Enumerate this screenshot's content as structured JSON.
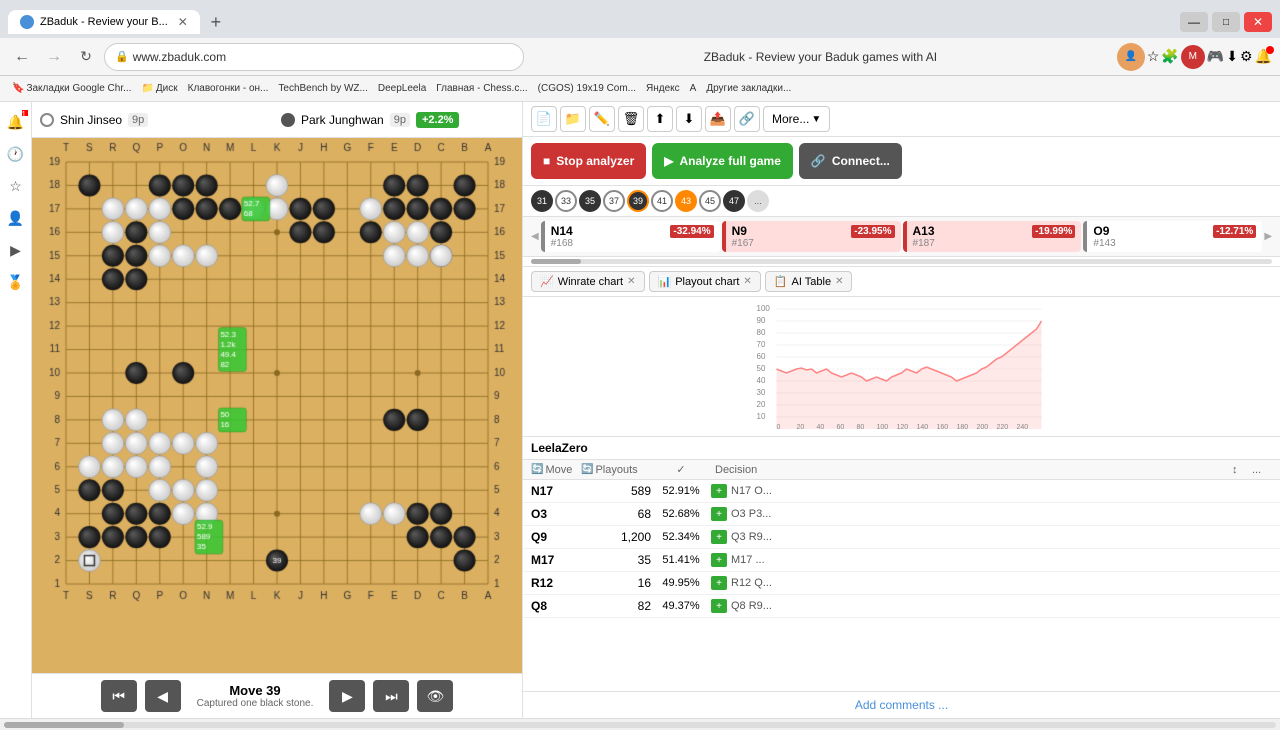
{
  "browser": {
    "tab_title": "ZBaduk - Review your B...",
    "url": "www.zbaduk.com",
    "page_title": "ZBaduk - Review your Baduk games with AI",
    "bookmarks": [
      {
        "label": "Закладки Google Chr...",
        "favicon": true
      },
      {
        "label": "Диск",
        "favicon": true
      },
      {
        "label": "Клавогонки - он...",
        "favicon": true
      },
      {
        "label": "TechBench by WZ...",
        "favicon": true
      },
      {
        "label": "DeepLeela",
        "favicon": true
      },
      {
        "label": "Главная - Chess.c...",
        "favicon": true
      },
      {
        "label": "(CGOS) 19x19 Com...",
        "favicon": true
      },
      {
        "label": "Яндекс",
        "favicon": true
      },
      {
        "label": "А",
        "favicon": true
      },
      {
        "label": "Другие закладки...",
        "favicon": false
      }
    ]
  },
  "players": {
    "white": {
      "name": "Shin Jinseo",
      "rank": "9p",
      "stone": "white"
    },
    "black": {
      "name": "Park Junghwan",
      "rank": "9p",
      "stone": "black"
    },
    "score_diff": "+2.2%"
  },
  "game": {
    "move_number": "Move 39",
    "move_sub": "Captured one black stone."
  },
  "toolbar": {
    "more_label": "More...",
    "stop_label": "Stop analyzer",
    "analyze_label": "Analyze full game",
    "connect_label": "Connect..."
  },
  "move_sequence": [
    {
      "num": "31",
      "color": "black"
    },
    {
      "num": "33",
      "color": "white"
    },
    {
      "num": "35",
      "color": "black"
    },
    {
      "num": "37",
      "color": "white"
    },
    {
      "num": "39",
      "color": "black",
      "current": true
    },
    {
      "num": "41",
      "color": "white"
    },
    {
      "num": "43",
      "color": "black",
      "highlight": true
    },
    {
      "num": "45",
      "color": "white"
    },
    {
      "num": "47",
      "color": "black"
    },
    {
      "num": "...",
      "color": "white"
    }
  ],
  "analysis_cards": [
    {
      "move": "N14",
      "num": "#168",
      "loss": "-32.94%"
    },
    {
      "move": "N9",
      "num": "#167",
      "loss": "-23.95%"
    },
    {
      "move": "A13",
      "num": "#187",
      "loss": "-19.99%"
    },
    {
      "move": "O9",
      "num": "#143",
      "loss": "-12.71%"
    }
  ],
  "chart": {
    "winrate_tab": "Winrate chart",
    "playout_tab": "Playout chart",
    "ai_table_tab": "AI Table",
    "y_labels": [
      "100",
      "90",
      "80",
      "70",
      "60",
      "50",
      "40",
      "30",
      "20",
      "10"
    ],
    "x_labels": [
      "0",
      "20",
      "40",
      "60",
      "80",
      "100",
      "120",
      "140",
      "160",
      "180",
      "200",
      "220",
      "240"
    ]
  },
  "ai_table": {
    "engine": "LeelaZero",
    "headers": {
      "move": "Move",
      "playouts": "Playouts",
      "winrate_check": "✓",
      "decision": "Decision",
      "sort": "↕",
      "extra": "..."
    },
    "rows": [
      {
        "move": "N17",
        "playouts": "589",
        "winrate": "52.91%",
        "decision": "N17 O...",
        "has_plus": true
      },
      {
        "move": "O3",
        "playouts": "68",
        "winrate": "52.68%",
        "decision": "O3 P3...",
        "has_plus": true
      },
      {
        "move": "Q9",
        "playouts": "1,200",
        "winrate": "52.34%",
        "decision": "Q3 R9...",
        "has_plus": true
      },
      {
        "move": "M17",
        "playouts": "35",
        "winrate": "51.41%",
        "decision": "M17 ...",
        "has_plus": true
      },
      {
        "move": "R12",
        "playouts": "16",
        "winrate": "49.95%",
        "decision": "R12 Q...",
        "has_plus": true
      },
      {
        "move": "Q8",
        "playouts": "82",
        "winrate": "49.37%",
        "decision": "Q8 R9...",
        "has_plus": true
      }
    ],
    "add_comments": "Add comments ..."
  },
  "board": {
    "size": 19,
    "column_labels": [
      "T",
      "S",
      "R",
      "Q",
      "P",
      "O",
      "N",
      "M",
      "L",
      "K",
      "J",
      "H",
      "G",
      "F",
      "E",
      "D",
      "C",
      "B",
      "A"
    ],
    "row_labels": [
      "19",
      "18",
      "17",
      "16",
      "15",
      "14",
      "13",
      "12",
      "11",
      "10",
      "9",
      "8",
      "7",
      "6",
      "5",
      "4",
      "3",
      "2",
      "1"
    ],
    "black_stones": [
      [
        2,
        2
      ],
      [
        3,
        5
      ],
      [
        3,
        6
      ],
      [
        4,
        4
      ],
      [
        4,
        5
      ],
      [
        4,
        6
      ],
      [
        4,
        10
      ],
      [
        5,
        2
      ],
      [
        6,
        2
      ],
      [
        6,
        3
      ],
      [
        6,
        10
      ],
      [
        7,
        2
      ],
      [
        7,
        3
      ],
      [
        8,
        3
      ],
      [
        11,
        3
      ],
      [
        11,
        4
      ],
      [
        12,
        3
      ],
      [
        12,
        4
      ],
      [
        2,
        17
      ],
      [
        3,
        17
      ],
      [
        2,
        15
      ],
      [
        3,
        15
      ],
      [
        3,
        16
      ],
      [
        4,
        16
      ],
      [
        4,
        17
      ],
      [
        5,
        16
      ],
      [
        5,
        17
      ],
      [
        15,
        2
      ],
      [
        15,
        3
      ],
      [
        16,
        2
      ],
      [
        16,
        3
      ],
      [
        17,
        3
      ],
      [
        17,
        4
      ],
      [
        17,
        5
      ],
      [
        18,
        2
      ],
      [
        18,
        3
      ],
      [
        16,
        16
      ],
      [
        17,
        16
      ],
      [
        16,
        17
      ],
      [
        17,
        17
      ],
      [
        18,
        17
      ],
      [
        18,
        18
      ],
      [
        15,
        12
      ],
      [
        16,
        12
      ],
      [
        14,
        4
      ]
    ],
    "white_stones": [
      [
        3,
        3
      ],
      [
        4,
        3
      ],
      [
        5,
        3
      ],
      [
        5,
        4
      ],
      [
        5,
        5
      ],
      [
        6,
        5
      ],
      [
        7,
        5
      ],
      [
        3,
        4
      ],
      [
        4,
        14
      ],
      [
        5,
        14
      ],
      [
        5,
        15
      ],
      [
        6,
        15
      ],
      [
        6,
        16
      ],
      [
        7,
        15
      ],
      [
        7,
        16
      ],
      [
        10,
        2
      ],
      [
        10,
        3
      ],
      [
        9,
        3
      ],
      [
        14,
        3
      ],
      [
        15,
        4
      ],
      [
        15,
        5
      ],
      [
        16,
        4
      ],
      [
        16,
        5
      ],
      [
        17,
        5
      ],
      [
        3,
        13
      ],
      [
        3,
        14
      ],
      [
        4,
        13
      ],
      [
        5,
        13
      ],
      [
        6,
        13
      ],
      [
        7,
        13
      ],
      [
        7,
        14
      ],
      [
        14,
        16
      ],
      [
        15,
        16
      ],
      [
        2,
        14
      ],
      [
        3,
        12
      ],
      [
        4,
        12
      ]
    ],
    "annotations": [
      {
        "row": 17,
        "col": 5,
        "text": "52.9\n589\n35"
      },
      {
        "row": 12,
        "col": 6,
        "text": "50\n16"
      },
      {
        "row": 9,
        "col": 6,
        "text": "52.3\n1.2k\n49.4\n82"
      },
      {
        "row": 3,
        "col": 7,
        "text": "52.7\n68"
      }
    ]
  }
}
